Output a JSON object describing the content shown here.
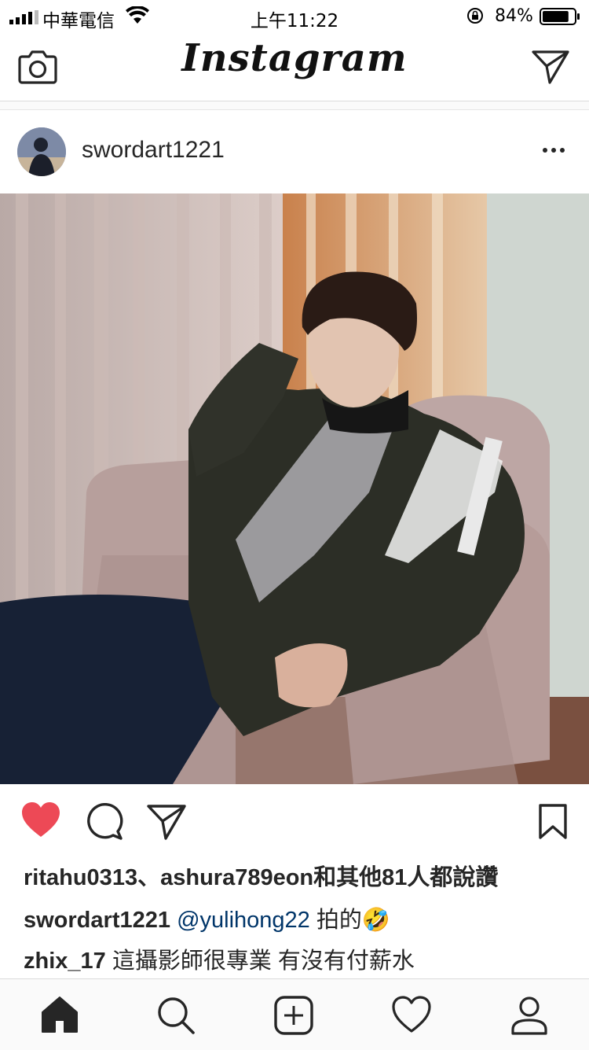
{
  "status_bar": {
    "carrier": "中華電信",
    "time": "上午11:22",
    "battery_percent": "84%",
    "battery_level": 0.84,
    "icons": [
      "signal-icon",
      "wifi-icon",
      "orientation-lock-icon",
      "battery-icon"
    ]
  },
  "header": {
    "logo": "Instagram",
    "left_icon": "camera-icon",
    "right_icon": "direct-message-icon"
  },
  "post": {
    "username": "swordart1221",
    "more_icon": "more-icon",
    "photo_icon": "photo",
    "actions": [
      "heart-icon",
      "comment-icon",
      "share-icon",
      "bookmark-icon"
    ],
    "liked": true,
    "like_color": "#ed4956",
    "likes": {
      "user1": "ritahu0313",
      "separator": "、",
      "user2": "ashura789eon",
      "suffix": "和其他81人都說讚"
    },
    "comments": [
      {
        "user": "swordart1221",
        "mention": "@yulihong22",
        "text": " 拍的🤣"
      },
      {
        "user": "zhix_17",
        "mention": "",
        "text": " 這攝影師很專業 有沒有付薪水"
      }
    ]
  },
  "bottom_nav": [
    "home-icon",
    "search-icon",
    "add-post-icon",
    "activity-heart-icon",
    "profile-icon"
  ],
  "mention_color": "#003569"
}
